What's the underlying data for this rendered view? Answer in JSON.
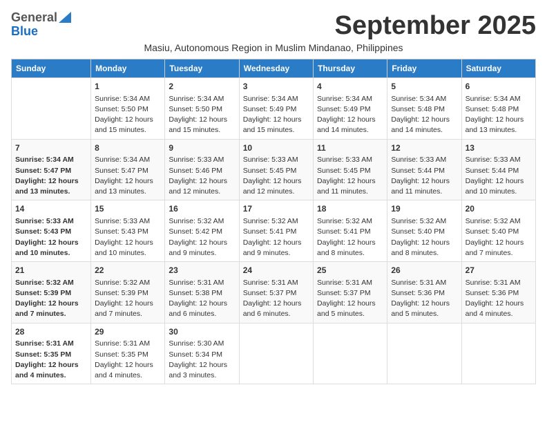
{
  "header": {
    "logo_general": "General",
    "logo_blue": "Blue",
    "month_title": "September 2025",
    "subtitle": "Masiu, Autonomous Region in Muslim Mindanao, Philippines"
  },
  "weekdays": [
    "Sunday",
    "Monday",
    "Tuesday",
    "Wednesday",
    "Thursday",
    "Friday",
    "Saturday"
  ],
  "weeks": [
    [
      {
        "day": "",
        "content": ""
      },
      {
        "day": "1",
        "content": "Sunrise: 5:34 AM\nSunset: 5:50 PM\nDaylight: 12 hours\nand 15 minutes."
      },
      {
        "day": "2",
        "content": "Sunrise: 5:34 AM\nSunset: 5:50 PM\nDaylight: 12 hours\nand 15 minutes."
      },
      {
        "day": "3",
        "content": "Sunrise: 5:34 AM\nSunset: 5:49 PM\nDaylight: 12 hours\nand 15 minutes."
      },
      {
        "day": "4",
        "content": "Sunrise: 5:34 AM\nSunset: 5:49 PM\nDaylight: 12 hours\nand 14 minutes."
      },
      {
        "day": "5",
        "content": "Sunrise: 5:34 AM\nSunset: 5:48 PM\nDaylight: 12 hours\nand 14 minutes."
      },
      {
        "day": "6",
        "content": "Sunrise: 5:34 AM\nSunset: 5:48 PM\nDaylight: 12 hours\nand 13 minutes."
      }
    ],
    [
      {
        "day": "7",
        "content": "Sunrise: 5:34 AM\nSunset: 5:47 PM\nDaylight: 12 hours\nand 13 minutes."
      },
      {
        "day": "8",
        "content": "Sunrise: 5:34 AM\nSunset: 5:47 PM\nDaylight: 12 hours\nand 13 minutes."
      },
      {
        "day": "9",
        "content": "Sunrise: 5:33 AM\nSunset: 5:46 PM\nDaylight: 12 hours\nand 12 minutes."
      },
      {
        "day": "10",
        "content": "Sunrise: 5:33 AM\nSunset: 5:45 PM\nDaylight: 12 hours\nand 12 minutes."
      },
      {
        "day": "11",
        "content": "Sunrise: 5:33 AM\nSunset: 5:45 PM\nDaylight: 12 hours\nand 11 minutes."
      },
      {
        "day": "12",
        "content": "Sunrise: 5:33 AM\nSunset: 5:44 PM\nDaylight: 12 hours\nand 11 minutes."
      },
      {
        "day": "13",
        "content": "Sunrise: 5:33 AM\nSunset: 5:44 PM\nDaylight: 12 hours\nand 10 minutes."
      }
    ],
    [
      {
        "day": "14",
        "content": "Sunrise: 5:33 AM\nSunset: 5:43 PM\nDaylight: 12 hours\nand 10 minutes."
      },
      {
        "day": "15",
        "content": "Sunrise: 5:33 AM\nSunset: 5:43 PM\nDaylight: 12 hours\nand 10 minutes."
      },
      {
        "day": "16",
        "content": "Sunrise: 5:32 AM\nSunset: 5:42 PM\nDaylight: 12 hours\nand 9 minutes."
      },
      {
        "day": "17",
        "content": "Sunrise: 5:32 AM\nSunset: 5:41 PM\nDaylight: 12 hours\nand 9 minutes."
      },
      {
        "day": "18",
        "content": "Sunrise: 5:32 AM\nSunset: 5:41 PM\nDaylight: 12 hours\nand 8 minutes."
      },
      {
        "day": "19",
        "content": "Sunrise: 5:32 AM\nSunset: 5:40 PM\nDaylight: 12 hours\nand 8 minutes."
      },
      {
        "day": "20",
        "content": "Sunrise: 5:32 AM\nSunset: 5:40 PM\nDaylight: 12 hours\nand 7 minutes."
      }
    ],
    [
      {
        "day": "21",
        "content": "Sunrise: 5:32 AM\nSunset: 5:39 PM\nDaylight: 12 hours\nand 7 minutes."
      },
      {
        "day": "22",
        "content": "Sunrise: 5:32 AM\nSunset: 5:39 PM\nDaylight: 12 hours\nand 7 minutes."
      },
      {
        "day": "23",
        "content": "Sunrise: 5:31 AM\nSunset: 5:38 PM\nDaylight: 12 hours\nand 6 minutes."
      },
      {
        "day": "24",
        "content": "Sunrise: 5:31 AM\nSunset: 5:37 PM\nDaylight: 12 hours\nand 6 minutes."
      },
      {
        "day": "25",
        "content": "Sunrise: 5:31 AM\nSunset: 5:37 PM\nDaylight: 12 hours\nand 5 minutes."
      },
      {
        "day": "26",
        "content": "Sunrise: 5:31 AM\nSunset: 5:36 PM\nDaylight: 12 hours\nand 5 minutes."
      },
      {
        "day": "27",
        "content": "Sunrise: 5:31 AM\nSunset: 5:36 PM\nDaylight: 12 hours\nand 4 minutes."
      }
    ],
    [
      {
        "day": "28",
        "content": "Sunrise: 5:31 AM\nSunset: 5:35 PM\nDaylight: 12 hours\nand 4 minutes."
      },
      {
        "day": "29",
        "content": "Sunrise: 5:31 AM\nSunset: 5:35 PM\nDaylight: 12 hours\nand 4 minutes."
      },
      {
        "day": "30",
        "content": "Sunrise: 5:30 AM\nSunset: 5:34 PM\nDaylight: 12 hours\nand 3 minutes."
      },
      {
        "day": "",
        "content": ""
      },
      {
        "day": "",
        "content": ""
      },
      {
        "day": "",
        "content": ""
      },
      {
        "day": "",
        "content": ""
      }
    ]
  ]
}
